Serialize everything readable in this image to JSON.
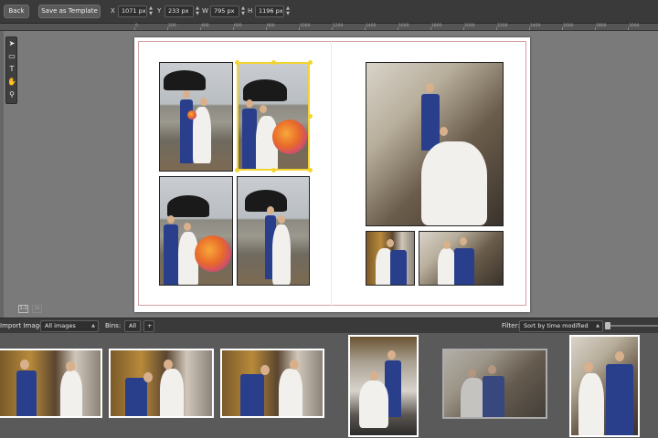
{
  "toolbar": {
    "back_label": "Back",
    "save_template_label": "Save as Template",
    "x_label": "X",
    "x_value": "1071 px",
    "y_label": "Y",
    "y_value": "233 px",
    "w_label": "W",
    "w_value": "795 px",
    "h_label": "H",
    "h_value": "1196 px"
  },
  "ruler": {
    "ticks": [
      "0",
      "200",
      "400",
      "600",
      "800",
      "1000",
      "1200",
      "1400",
      "1600",
      "1800",
      "2000",
      "2200",
      "2400",
      "2600",
      "2800",
      "3000",
      "3200",
      "3400",
      "3600",
      "3800"
    ]
  },
  "tools": {
    "select_icon": "arrow-pointer-icon",
    "frame_icon": "rectangle-frame-icon",
    "text_icon": "text-tool-icon",
    "pan_icon": "hand-icon",
    "zoom_icon": "magnifier-icon"
  },
  "view": {
    "actual_size_label": "1:1",
    "fit_icon": "fit-page-icon"
  },
  "images_panel": {
    "import_label": "Import Images",
    "source_value": "All images",
    "bins_label": "Bins:",
    "bins_value": "All",
    "add_bin_label": "+",
    "filter_label": "Filter:",
    "sort_value": "Sort by time modified"
  },
  "colors": {
    "selection": "#f2d531",
    "margin_guide": "#d4a0a0",
    "toolbar_bg": "#3a3a3a",
    "workspace_bg": "#7a7a7a"
  }
}
